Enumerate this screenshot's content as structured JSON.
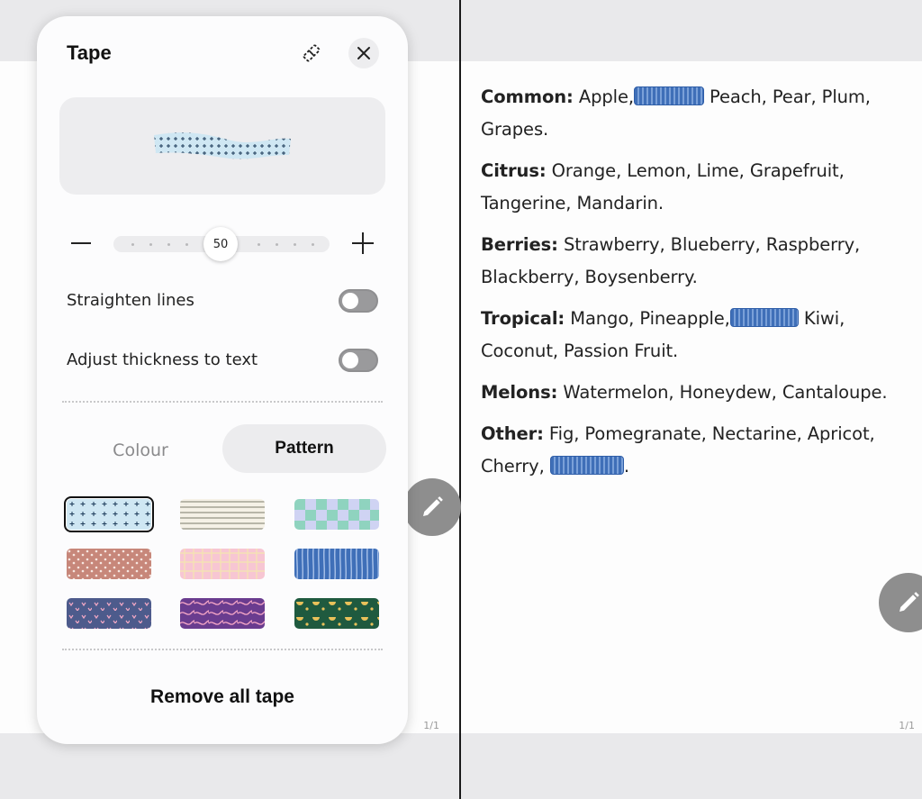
{
  "panel": {
    "title": "Tape",
    "slider_value": "50",
    "option_straighten": "Straighten lines",
    "option_adjust": "Adjust thickness to text",
    "tab_colour": "Colour",
    "tab_pattern": "Pattern",
    "remove_all": "Remove all tape"
  },
  "page_numbers": {
    "left": "1/1",
    "right": "1/1"
  },
  "note": {
    "lines": [
      {
        "label": "Common:",
        "text_before": " Apple,",
        "text_after": " Peach, Pear, Plum, Grapes."
      },
      {
        "label": "Citrus:",
        "text": " Orange, Lemon, Lime, Grapefruit, Tangerine, Mandarin."
      },
      {
        "label": "Berries:",
        "text": " Strawberry, Blueberry, Raspberry, Blackberry, Boysenberry."
      },
      {
        "label": "Tropical:",
        "text_before": " Mango, Pineapple,",
        "text_after": " Kiwi, Coconut, Passion Fruit."
      },
      {
        "label": "Melons:",
        "text": " Watermelon, Honeydew, Cantaloupe."
      },
      {
        "label": "Other:",
        "text_before": " Fig, Pomegranate, Nectarine, Apricot, Cherry,",
        "text_after": "."
      }
    ]
  },
  "icons": {
    "eraser": "tape-eraser-icon",
    "close": "close-icon",
    "minus": "minus-icon",
    "plus": "plus-icon",
    "pen": "pen-icon"
  },
  "colors": {
    "accent_tape": "#3f6fb8",
    "toggle_off": "#9a9a9c",
    "panel_bg": "#fcfcfd"
  }
}
